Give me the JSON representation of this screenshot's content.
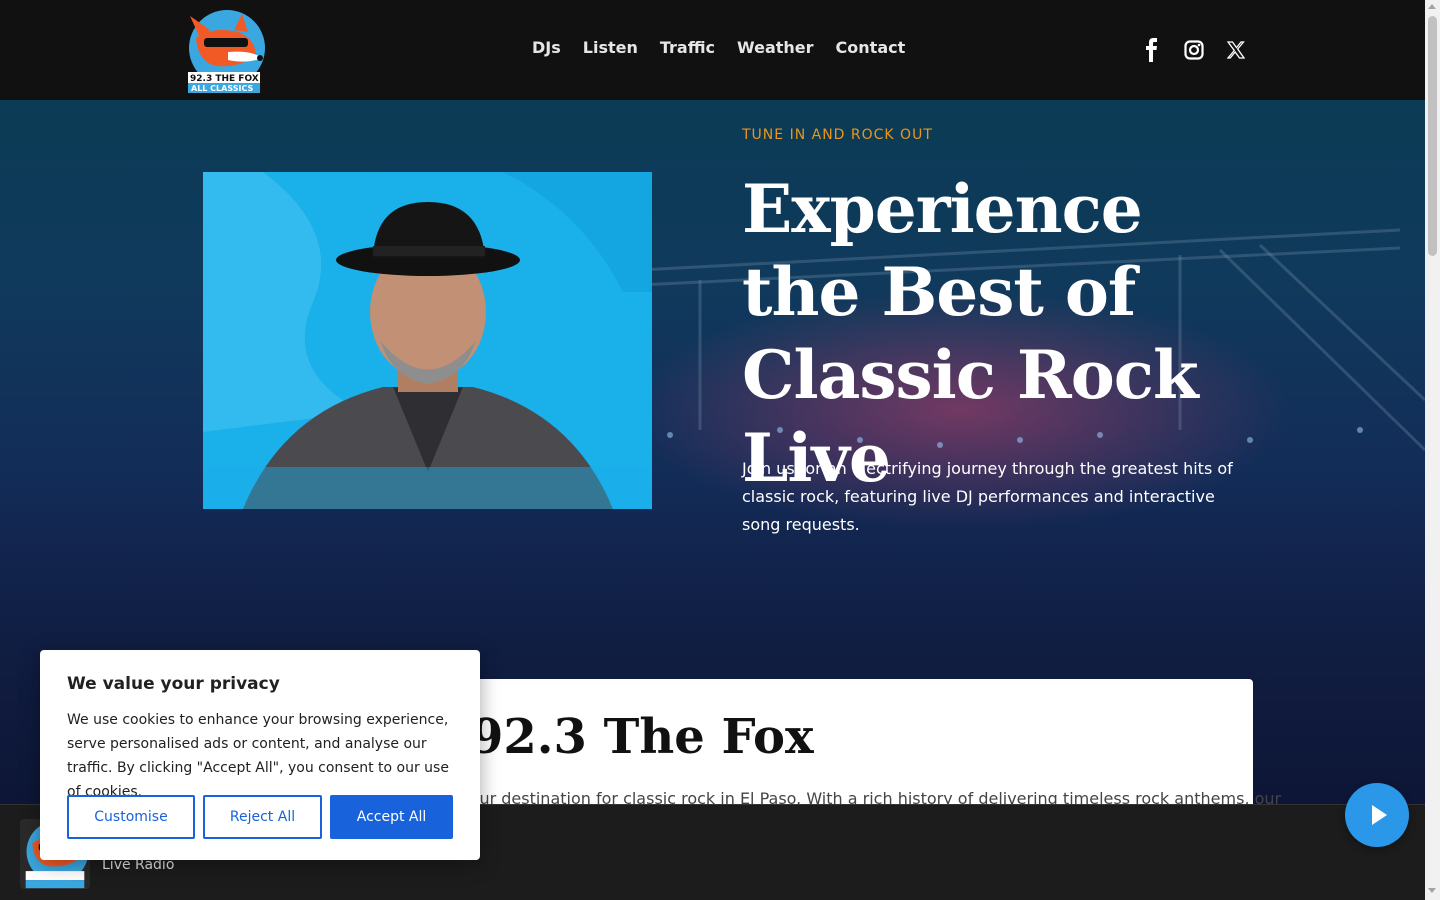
{
  "header": {
    "logo_text": [
      "92.3 THE FOX",
      "ALL CLASSICS"
    ],
    "nav": [
      "DJs",
      "Listen",
      "Traffic",
      "Weather",
      "Contact"
    ],
    "social_icons": [
      "facebook-icon",
      "instagram-icon",
      "x-twitter-icon"
    ]
  },
  "hero": {
    "eyebrow": "TUNE IN AND ROCK OUT",
    "headline": "Experience the Best of Classic Rock Live",
    "lead": "Join us for an electrifying journey through the greatest hits of classic rock, featuring live DJ performances and interactive song requests."
  },
  "about": {
    "title": "92.3 The Fox",
    "text": "Your destination for classic rock in El Paso. With a rich history of delivering timeless rock anthems, our"
  },
  "player": {
    "subtitle": "Live Radio",
    "play_icon": "play-icon"
  },
  "cookie": {
    "title": "We value your privacy",
    "body": "We use cookies to enhance your browsing experience, serve personalised ads or content, and analyse our traffic. By clicking \"Accept All\", you consent to our use of cookies.",
    "customise": "Customise",
    "reject": "Reject All",
    "accept": "Accept All"
  },
  "colors": {
    "accent_orange": "#e8961e",
    "brand_blue": "#1863dc",
    "play_blue": "#2b97e8",
    "header_bg": "#111111"
  }
}
